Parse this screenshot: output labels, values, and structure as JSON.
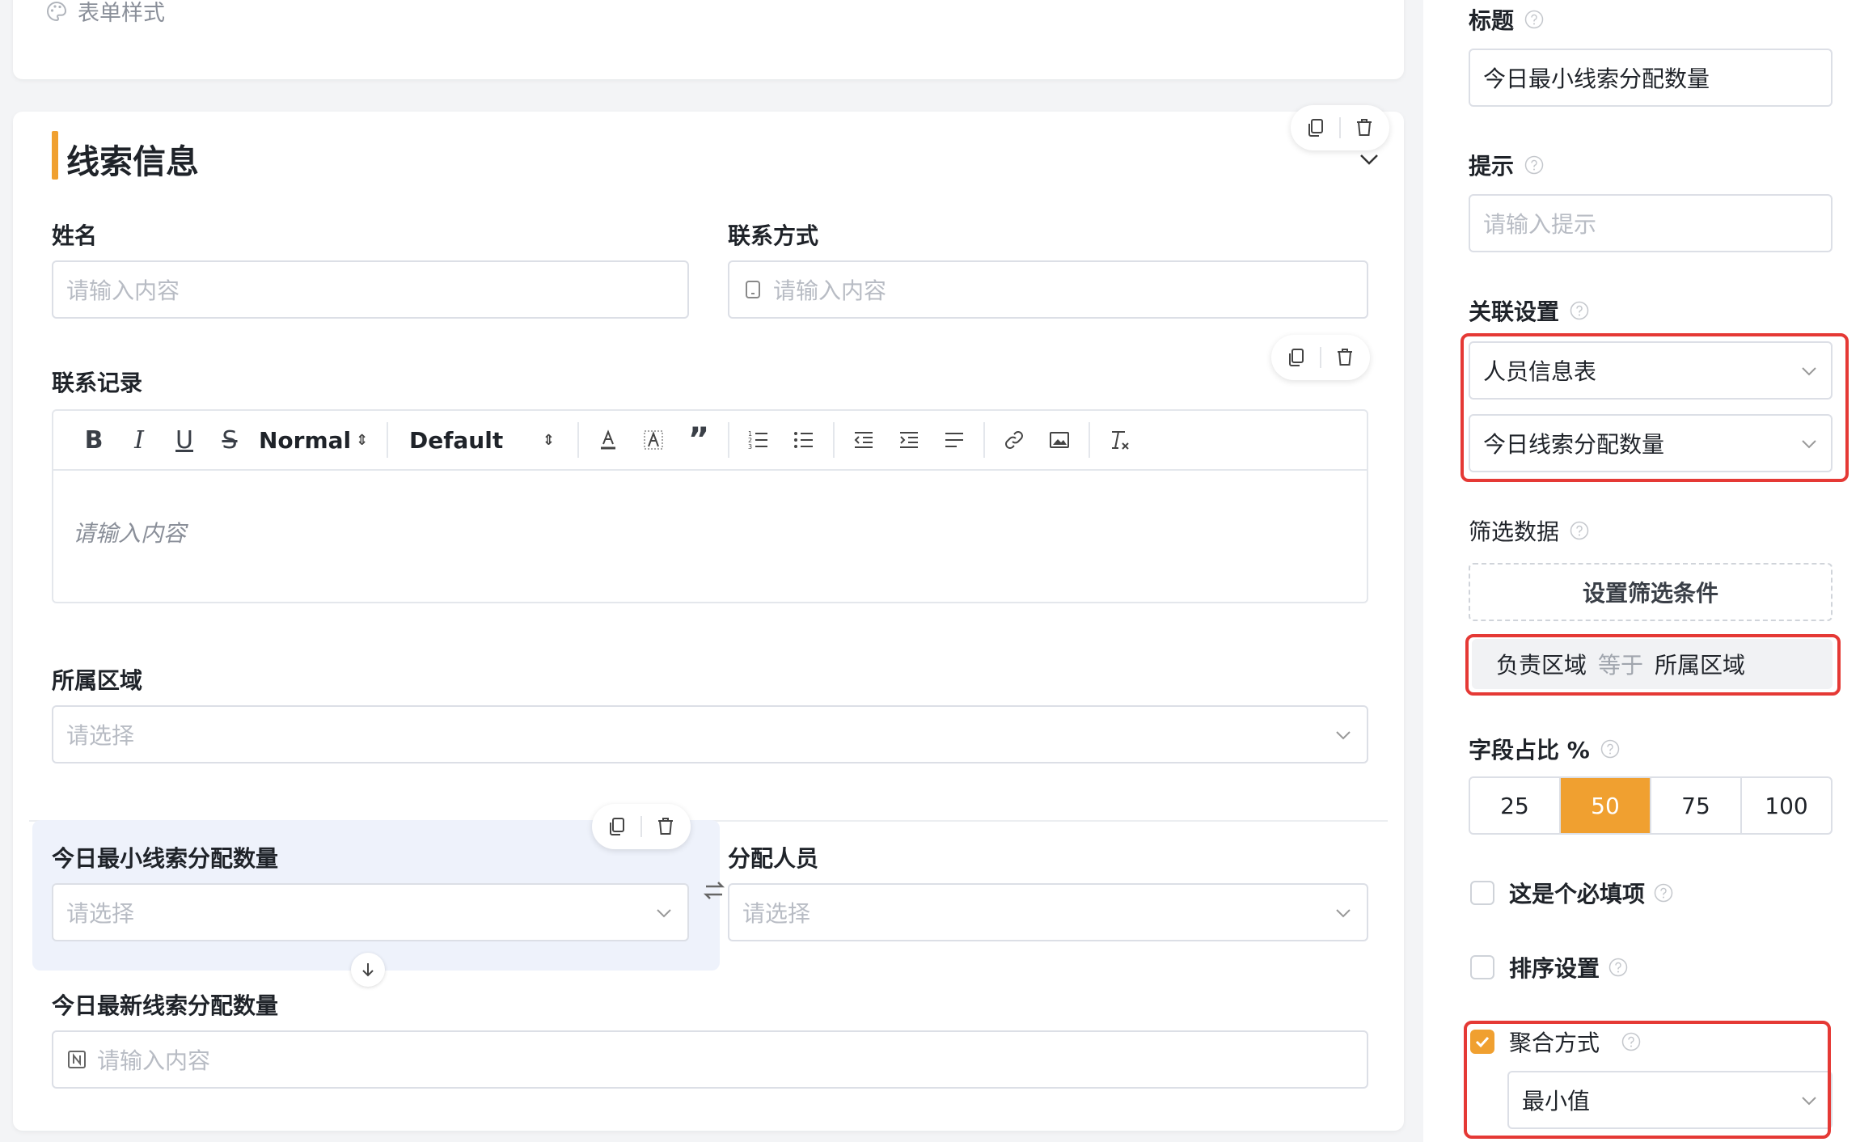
{
  "form_style": {
    "label": "表单样式",
    "icon": "palette-icon"
  },
  "section": {
    "title": "线索信息"
  },
  "fields": {
    "name": {
      "label": "姓名",
      "placeholder": "请输入内容"
    },
    "contact": {
      "label": "联系方式",
      "placeholder": "请输入内容"
    },
    "record": {
      "label": "联系记录",
      "placeholder": "请输入内容",
      "toolbar": {
        "heading_select": "Normal",
        "font_select": "Default"
      }
    },
    "region": {
      "label": "所属区域",
      "placeholder": "请选择"
    },
    "min_count": {
      "label": "今日最小线索分配数量",
      "placeholder": "请选择"
    },
    "assignee": {
      "label": "分配人员",
      "placeholder": "请选择"
    },
    "latest_count": {
      "label": "今日最新线索分配数量",
      "placeholder": "请输入内容"
    }
  },
  "panel": {
    "title_label": "标题",
    "title_value": "今日最小线索分配数量",
    "hint_label": "提示",
    "hint_placeholder": "请输入提示",
    "relation_label": "关联设置",
    "relation_table": "人员信息表",
    "relation_field": "今日线索分配数量",
    "filter_label": "筛选数据",
    "filter_button": "设置筛选条件",
    "condition": {
      "field": "负责区域",
      "operator": "等于",
      "value": "所属区域"
    },
    "width_label": "字段占比 %",
    "width_options": [
      "25",
      "50",
      "75",
      "100"
    ],
    "width_selected": "50",
    "required_label": "这是个必填项",
    "required_checked": false,
    "sort_label": "排序设置",
    "sort_checked": false,
    "aggregate_label": "聚合方式",
    "aggregate_checked": true,
    "aggregate_value": "最小值"
  },
  "colors": {
    "accent": "#f0a030",
    "highlight": "#e53935",
    "selected_field_bg": "#eef2fb"
  }
}
